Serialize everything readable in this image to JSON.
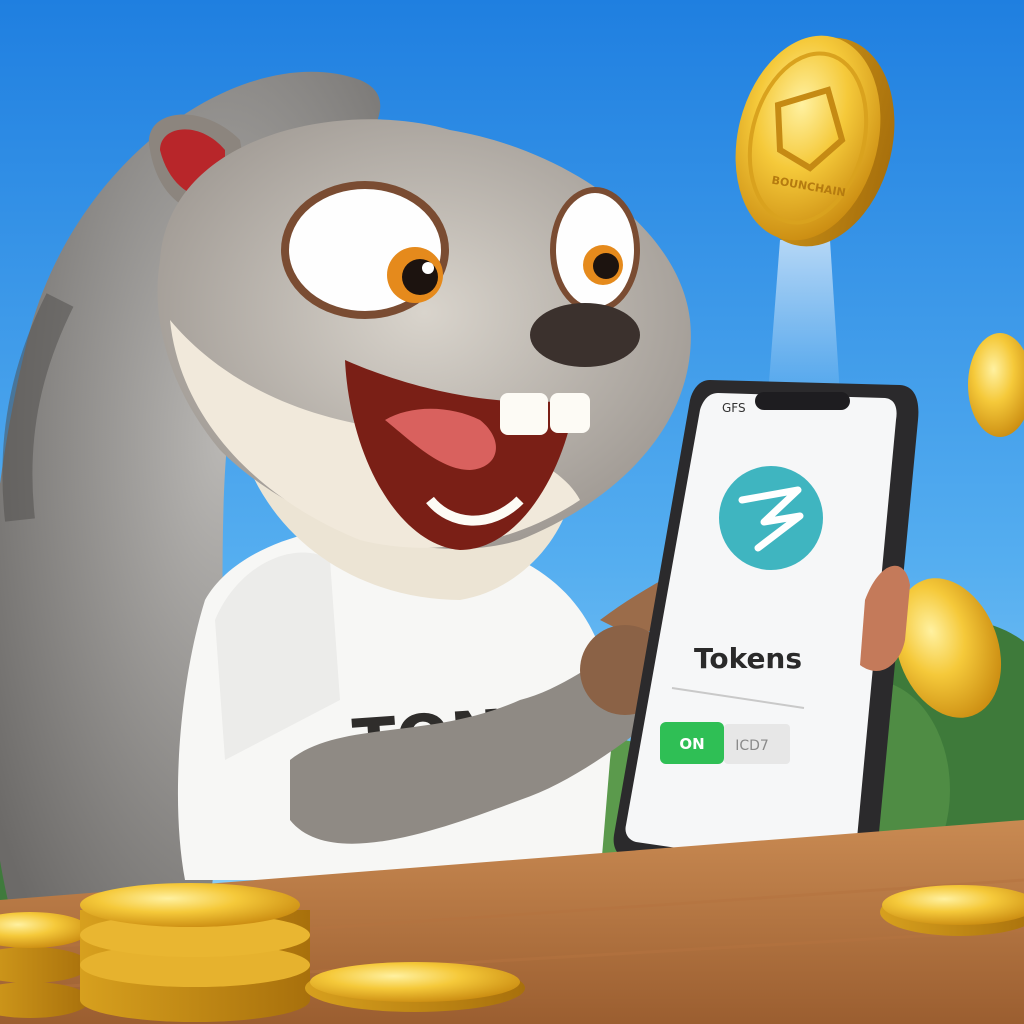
{
  "shirt": {
    "text": "TON"
  },
  "coin": {
    "text": "BOUNCHAIN"
  },
  "phone": {
    "status_left": "GFS",
    "logo_icon": "ton-logo-icon",
    "title": "Tokens",
    "toggle_label": "ON",
    "toggle_side_text": "ICD7",
    "toggle_state": true
  },
  "colors": {
    "sky_top": "#1f7fe0",
    "sky_bottom": "#8fd0f6",
    "logo": "#3fb5c0",
    "toggle": "#2fbf55",
    "gold": "#f2c233"
  }
}
